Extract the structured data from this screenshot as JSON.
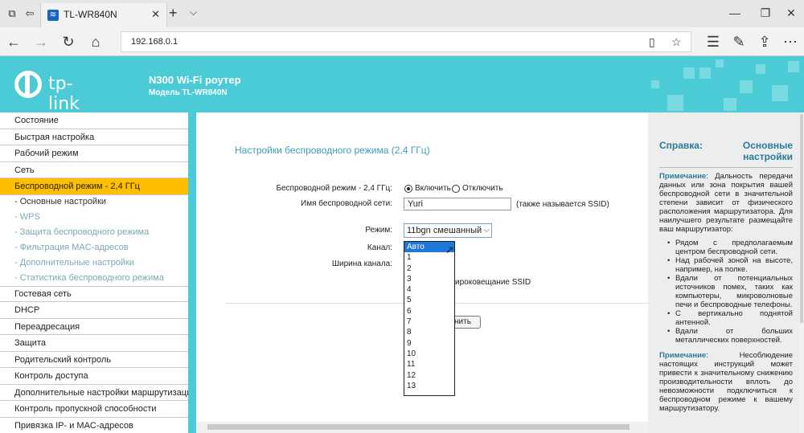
{
  "browser": {
    "tab_title": "TL-WR840N",
    "url": "192.168.0.1",
    "icons": [
      "tab-preview-icon",
      "set-aside-icon",
      "close-icon",
      "new-tab-icon",
      "chevron-down-icon",
      "minimize-icon",
      "restore-icon",
      "window-close-icon",
      "back-icon",
      "forward-icon",
      "refresh-icon",
      "home-icon",
      "reading-view-icon",
      "favorite-star-icon",
      "favorites-hub-icon",
      "pen-icon",
      "share-icon",
      "more-icon"
    ]
  },
  "router": {
    "brand": "tp-link",
    "product": "N300 Wi-Fi роутер",
    "model": "Модель TL-WR840N",
    "header_color": "#4acbd6"
  },
  "sidebar": {
    "items": [
      {
        "label": "Состояние"
      },
      {
        "label": "Быстрая настройка"
      },
      {
        "label": "Рабочий режим"
      },
      {
        "label": "Сеть"
      },
      {
        "label": "Беспроводной режим - 2,4 ГГц"
      },
      {
        "label": "- Основные настройки"
      },
      {
        "label": "- WPS"
      },
      {
        "label": "- Защита беспроводного режима"
      },
      {
        "label": "- Фильтрация MAC-адресов"
      },
      {
        "label": "- Дополнительные настройки"
      },
      {
        "label": "- Статистика беспроводного режима"
      },
      {
        "label": "Гостевая сеть"
      },
      {
        "label": "DHCP"
      },
      {
        "label": "Переадресация"
      },
      {
        "label": "Защита"
      },
      {
        "label": "Родительский контроль"
      },
      {
        "label": "Контроль доступа"
      },
      {
        "label": "Дополнительные настройки маршрутизации"
      },
      {
        "label": "Контроль пропускной способности"
      },
      {
        "label": "Привязка IP- и MAC-адресов"
      }
    ],
    "active_color": "#ffbf00"
  },
  "main": {
    "title": "Настройки беспроводного режима (2,4 ГГц)",
    "wireless_label": "Беспроводной режим - 2,4 ГГц:",
    "enable_label": "Включить",
    "disable_label": "Отключить",
    "ssid_label": "Имя беспроводной сети:",
    "ssid_value": "Yuri",
    "ssid_note": "(также называется SSID)",
    "mode_label": "Режим:",
    "mode_value": "11bgn смешанный",
    "channel_label": "Канал:",
    "width_label": "Ширина канала:",
    "broadcast_label": "ироковещание SSID",
    "save_label": "нить",
    "channel_options": [
      "Авто",
      "1",
      "2",
      "3",
      "4",
      "5",
      "6",
      "7",
      "8",
      "9",
      "10",
      "11",
      "12",
      "13"
    ],
    "channel_selected": "Авто"
  },
  "help": {
    "title_left": "Справка:",
    "title_right": "Основные настройки",
    "note1_label": "Примечание",
    "note1_text": ": Дальность передачи данных или зона покрытия вашей беспроводной сети в значительной степени зависит от физического расположения маршрутизатора. Для наилучшего результате размещайте ваш маршрутизатор:",
    "bullets": [
      "Рядом с предполагаемым центром беспроводной сети.",
      "Над рабочей зоной на высоте, например, на полке.",
      "Вдали от потенциальных источников помех, таких как компьютеры, микроволновые печи и беспроводные телефоны.",
      "С вертикально поднятой антенной.",
      "Вдали от больших металлических поверхностей."
    ],
    "note2_label": "Примечание",
    "note2_text": ": Несоблюдение настоящих инструкций может привести к значительному снижению производительности вплоть до невозможности подключиться к беспроводном режиме к вашему маршрутизатору."
  }
}
